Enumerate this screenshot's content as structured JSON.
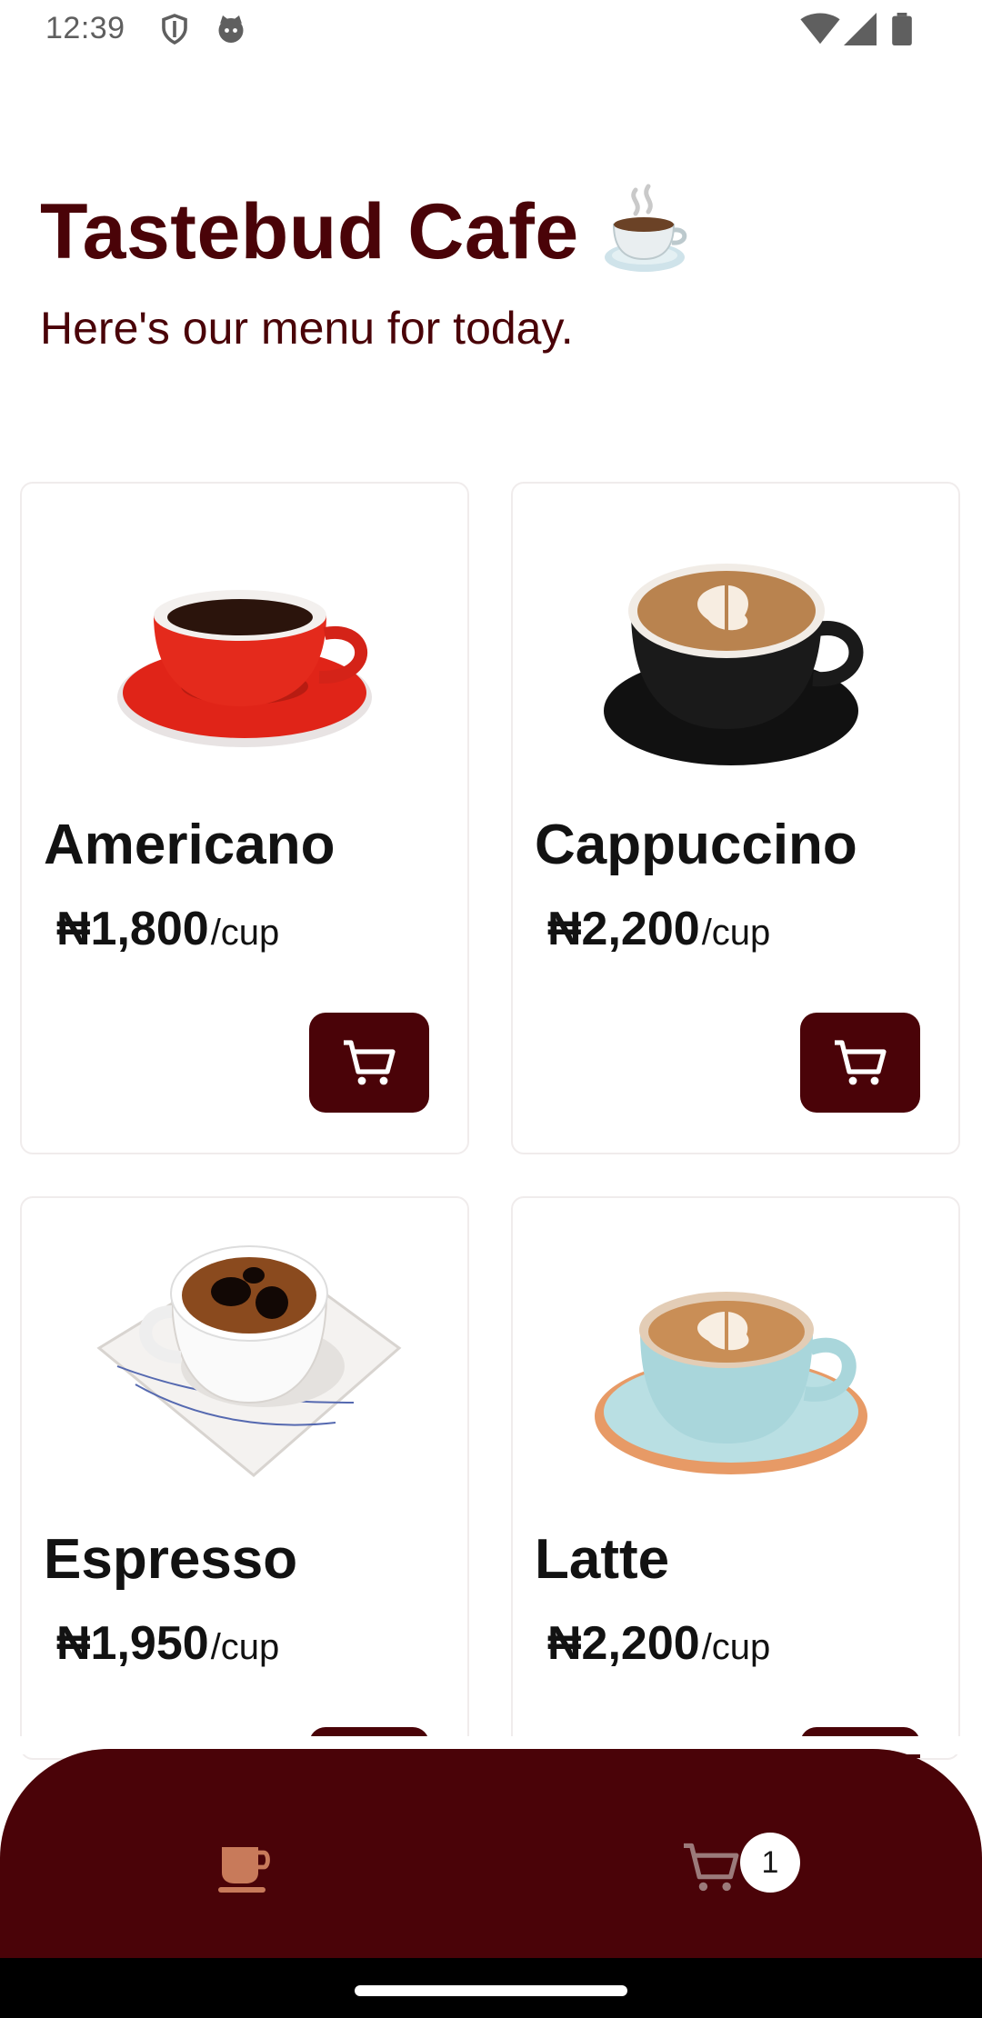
{
  "status_bar": {
    "time": "12:39",
    "icons": [
      "shield-icon",
      "cat-icon",
      "wifi-icon",
      "signal-icon",
      "battery-icon"
    ]
  },
  "header": {
    "title": "Tastebud Cafe",
    "title_emoji_icon": "coffee-cup-icon",
    "subtitle": "Here's our menu for today."
  },
  "menu": {
    "items": [
      {
        "name": "Americano",
        "price": "₦1,800",
        "unit": "/cup",
        "image_icon": "red-coffee-cup-icon"
      },
      {
        "name": "Cappuccino",
        "price": "₦2,200",
        "unit": "/cup",
        "image_icon": "black-cappuccino-cup-icon"
      },
      {
        "name": "Espresso",
        "price": "₦1,950",
        "unit": "/cup",
        "image_icon": "espresso-cup-icon"
      },
      {
        "name": "Latte",
        "price": "₦2,200",
        "unit": "/cup",
        "image_icon": "latte-cup-icon"
      }
    ],
    "add_to_cart_icon": "cart-icon"
  },
  "bottom_nav": {
    "items": [
      {
        "icon": "coffee-cup-icon",
        "active": true
      },
      {
        "icon": "cart-icon",
        "active": false
      }
    ],
    "cart_badge": "1"
  },
  "colors": {
    "brand": "#4a0308",
    "active_nav_icon": "#c87a5a",
    "inactive_nav_icon": "#9b7a7a"
  }
}
